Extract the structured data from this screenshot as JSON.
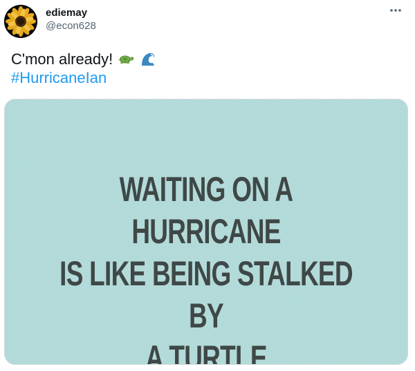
{
  "tweet": {
    "author": {
      "display_name": "ediemay",
      "handle": "@econ628",
      "avatar_icon": "sunflower-icon"
    },
    "more_icon": "more-options-icon",
    "text": "C'mon already!",
    "emojis": [
      "turtle-icon",
      "water-wave-icon"
    ],
    "hashtag": "#HurricaneIan",
    "media": {
      "background_color": "#a9d6d4",
      "text_color": "#3f4847",
      "lines": [
        "WAITING ON A HURRICANE",
        "IS LIKE BEING STALKED BY",
        "A TURTLE"
      ]
    }
  },
  "colors": {
    "text_primary": "#0f1419",
    "text_secondary": "#536471",
    "link": "#1d9bf0"
  }
}
